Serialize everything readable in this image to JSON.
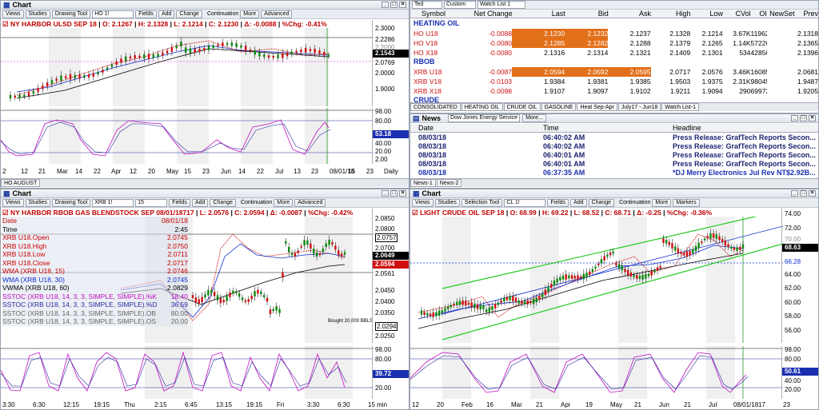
{
  "colors": {
    "price_up": "#0a8a0a",
    "price_down": "#d01010",
    "ma1": "#d02020",
    "ma2": "#1030d0",
    "ma3": "#000000",
    "stoch_k": "#c010c0",
    "stoch_d": "#2a2aa0",
    "channel": "#22cc22"
  },
  "ho_chart": {
    "title": "Chart",
    "symbol_value": "HO 1!",
    "toolbar": [
      "Views",
      "Studies",
      "Drawing Tool",
      "Fields",
      "Add",
      "Change"
    ],
    "continuation": "Continuation",
    "more": "More",
    "advanced": "Advanced",
    "caption_symbol": "NY HARBOR ULSD SEP 18",
    "o": "O: 2.1267",
    "h": "H: 2.1328",
    "l": "L: 2.1214",
    "c": "C: 2.1230",
    "d": "Δ: -0.0088",
    "pct": "%Chg: -0.41%",
    "axis": [
      "2.3000",
      "2.2286",
      "2.2000",
      "2.1543",
      "2.0769",
      "2.0000",
      "1.9000"
    ],
    "last_tag": "2.1543",
    "stoch_axis": [
      "98.00",
      "80.00",
      "53.18",
      "40.00",
      "20.00",
      "2.00"
    ],
    "stoch_tag": "53.18",
    "dates": [
      "2",
      "12",
      "21",
      "Mar",
      "14",
      "22",
      "Apr",
      "12",
      "20",
      "May",
      "15",
      "23",
      "Jun",
      "14",
      "22",
      "Jul",
      "13",
      "23",
      "08/01/18",
      "15",
      "23",
      "Daily"
    ],
    "subtab": "HO AUGUST"
  },
  "quotes": {
    "toolbar": [
      "Ted",
      "Custom",
      "Watch List 1"
    ],
    "columns": [
      "Symbol",
      "Net Change",
      "Last",
      "Bid",
      "Ask",
      "High",
      "Low",
      "CVol",
      "OI",
      "NewSet",
      "Prev"
    ],
    "sections": [
      {
        "name": "HEATING OIL",
        "rows": [
          [
            "HO U18",
            "-0.0088",
            "2.1230",
            "2.1232",
            "2.1237",
            "2.1328",
            "2.1214",
            "3.67K",
            "119626",
            "",
            "2.1318"
          ],
          [
            "HO V18",
            "-0.0080",
            "2.1285",
            "2.1282",
            "2.1288",
            "2.1379",
            "2.1265",
            "1.14K",
            "57226",
            "",
            "2.1365"
          ],
          [
            "HO X18",
            "-0.0080",
            "2.1316",
            "2.1314",
            "2.1321",
            "2.1409",
            "2.1301",
            "534",
            "42856",
            "",
            "2.1396"
          ]
        ]
      },
      {
        "name": "RBOB",
        "rows": [
          [
            "XRB U18",
            "-0.0087",
            "2.0594",
            "2.0592",
            "2.0595",
            "2.0717",
            "2.0576",
            "3.46K",
            "160855",
            "",
            "2.0681"
          ],
          [
            "XRB V18",
            "-0.0103",
            "1.9384",
            "1.9381",
            "1.9385",
            "1.9503",
            "1.9375",
            "2.31K",
            "98045",
            "",
            "1.9487"
          ],
          [
            "XRB X18",
            "-0.0098",
            "1.9107",
            "1.9097",
            "1.9102",
            "1.9211",
            "1.9094",
            "290",
            "69972",
            "",
            "1.9205"
          ]
        ]
      },
      {
        "name": "CRUDE",
        "rows": []
      }
    ],
    "tabs": [
      "CONSOLIDATED",
      "HEATING OIL",
      "CRUDE OIL",
      "GASOLINE",
      "Heat Sep-Apr",
      "July17 - Jun18",
      "Watch List-1"
    ]
  },
  "news": {
    "title": "News",
    "source": "Dow Jones Energy Service",
    "more": "More...",
    "columns": [
      "Date",
      "Time",
      "Headline"
    ],
    "rows": [
      [
        "08/03/18",
        "06:40:02 AM",
        "Press Release: GrafTech Reports Secon..."
      ],
      [
        "08/03/18",
        "06:40:02 AM",
        "Press Release: GrafTech Reports Secon..."
      ],
      [
        "08/03/18",
        "06:40:01 AM",
        "Press Release: GrafTech Reports Secon..."
      ],
      [
        "08/03/18",
        "06:40:01 AM",
        "Press Release: GrafTech Reports Secon..."
      ],
      [
        "08/03/18",
        "06:37:35 AM",
        "*DJ Merry Electronics Jul Rev NT$2.92B..."
      ]
    ],
    "tabs": [
      "News-1",
      "News-2"
    ]
  },
  "xrb_chart": {
    "title": "Chart",
    "symbol_value": "XRB 1!",
    "interval_value": "15",
    "toolbar": [
      "Views",
      "Studies",
      "Drawing Tool",
      "Fields",
      "Add",
      "Change"
    ],
    "continuation": "Continuation",
    "more": "More",
    "advanced": "Advanced",
    "caption_symbol": "NY HARBOR RBOB GAS BLENDSTOCK SEP",
    "caption_date": "08/01/18",
    "caption_rest": "717",
    "l": "L: 2.0576",
    "c": "C: 2.0594",
    "d": "Δ: -0.0087",
    "pct": "%Chg: -0.42%",
    "legend": [
      {
        "label": "Date",
        "value": "08/01/18"
      },
      {
        "label": "Time",
        "value": "2:45"
      },
      {
        "label": "XRB U18.Open",
        "value": "2.0745"
      },
      {
        "label": "XRB U18.High",
        "value": "2.0750"
      },
      {
        "label": "XRB U18.Low",
        "value": "2.0711"
      },
      {
        "label": "XRB U18.Close",
        "value": "2.0717"
      },
      {
        "label": "WMA (XRB U18, 15)",
        "value": "2.0746"
      },
      {
        "label": "WMA (XRB U18, 30)",
        "value": "2.0745"
      },
      {
        "label": "VWMA (XRB U18, 60)",
        "value": "2.0829"
      },
      {
        "label": "SSTOC (XRB U18, 14, 3, 3, SIMPLE, SIMPLE).%K",
        "value": "18.40"
      },
      {
        "label": "SSTOC (XRB U18, 14, 3, 3, SIMPLE, SIMPLE).%D",
        "value": "36.59"
      },
      {
        "label": "SSTOC (XRB U18, 14, 3, 3, SIMPLE, SIMPLE).OB",
        "value": "80.00"
      },
      {
        "label": "SSTOC (XRB U18, 14, 3, 3, SIMPLE, SIMPLE).OS",
        "value": "20.00"
      }
    ],
    "axis": [
      "2.0850",
      "2.0800",
      "2.0757",
      "2.0700",
      "2.0649",
      "2.0594",
      "2.0561",
      "2.0450",
      "2.0400",
      "2.0350",
      "2.0294",
      "2.0250"
    ],
    "bought": "Bought 20,000 BBLS",
    "stoch_axis": [
      "98.00",
      "80.00",
      "39.72",
      "20.00"
    ],
    "stoch_tag": "39.72",
    "dates": [
      "3:30",
      "6:30",
      "12:15",
      "19:15",
      "Thu",
      "2:15",
      "6:45",
      "13:15",
      "19:15",
      "Fri",
      "3:30",
      "6:30",
      "15 min"
    ]
  },
  "cl_chart": {
    "title": "Chart",
    "symbol_value": "CL 1!",
    "tool": "Selection Tool",
    "toolbar": [
      "Views",
      "Studies",
      "Fields",
      "Add",
      "Change",
      "Markers"
    ],
    "continuation": "Continuation",
    "more": "More",
    "caption_symbol": "LIGHT CRUDE OIL SEP 18",
    "o": "O: 68.99",
    "h": "H: 69.22",
    "l": "L: 68.52",
    "c": "C: 68.71",
    "d": "Δ: -0.25",
    "pct": "%Chg: -0.36%",
    "axis": [
      "74.00",
      "72.00",
      "70.00",
      "68.63",
      "66.28",
      "64.00",
      "62.00",
      "60.00",
      "58.00",
      "56.00"
    ],
    "last_tag": "68.63",
    "stoch_axis": [
      "98.00",
      "80.00",
      "50.61",
      "40.00",
      "20.00"
    ],
    "stoch_tag": "50.61",
    "dates": [
      "12",
      "20",
      "Feb",
      "16",
      "Mar",
      "21",
      "Apr",
      "19",
      "May",
      "21",
      "Jun",
      "21",
      "Jul",
      "08/01/18",
      "17",
      "23"
    ]
  }
}
